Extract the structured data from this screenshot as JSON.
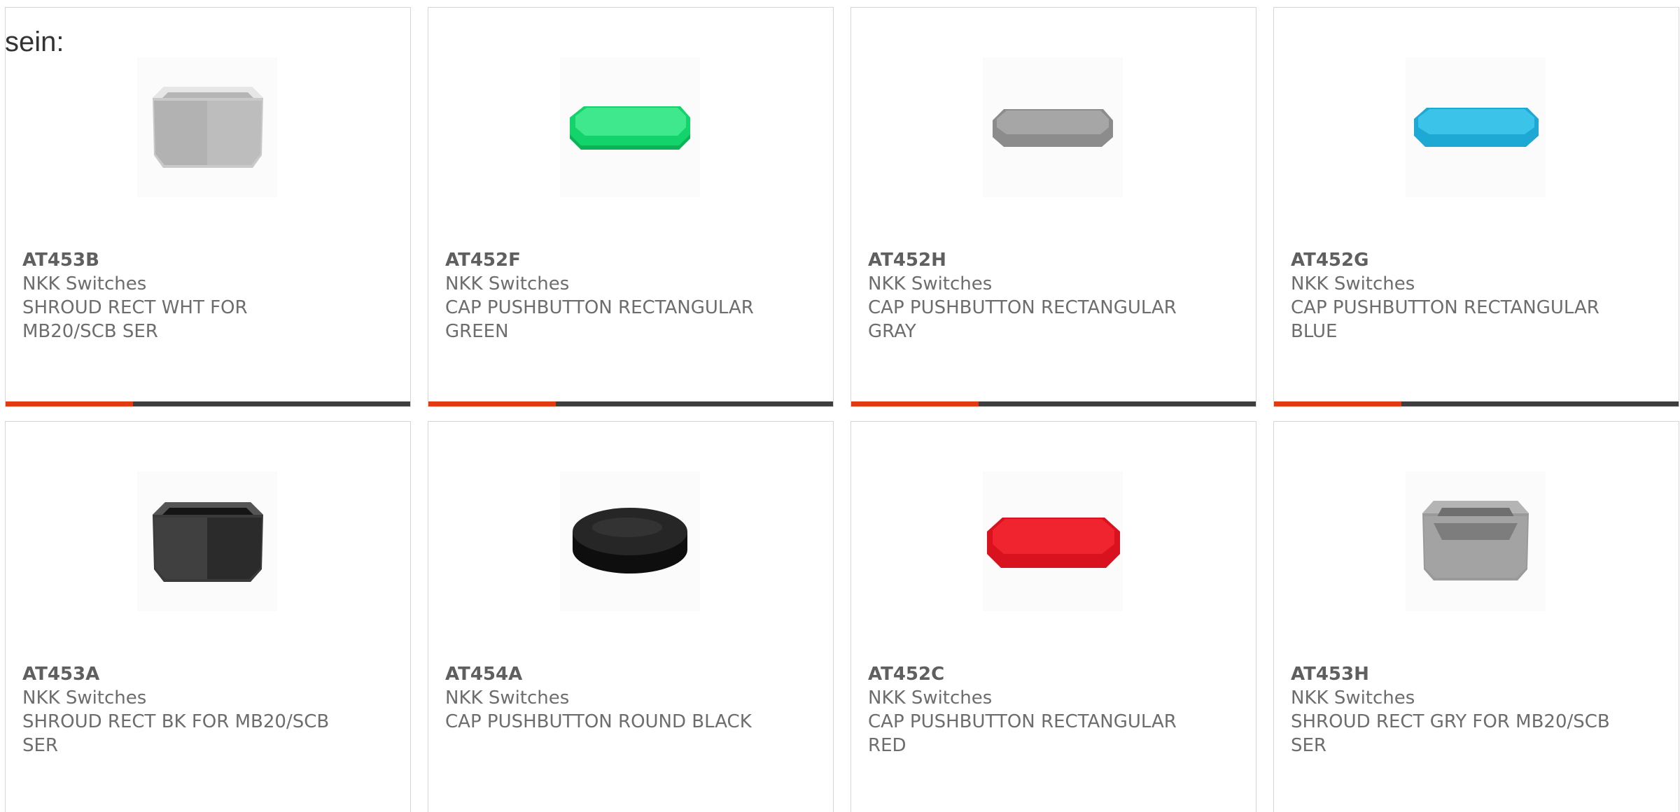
{
  "intro_text": "sein:",
  "colors": {
    "accent": "#e23b12",
    "bar": "#3e3e3e",
    "border": "#d6d6d6",
    "text": "#6d6d6d"
  },
  "products": [
    {
      "part": "AT453B",
      "manufacturer": "NKK Switches",
      "description": "SHROUD RECT WHT FOR MB20/SCB SER",
      "image": "white-rectangular-shroud-image"
    },
    {
      "part": "AT452F",
      "manufacturer": "NKK Switches",
      "description": "CAP PUSHBUTTON RECTANGULAR GREEN",
      "image": "green-rectangular-cap-image"
    },
    {
      "part": "AT452H",
      "manufacturer": "NKK Switches",
      "description": "CAP PUSHBUTTON RECTANGULAR GRAY",
      "image": "gray-rectangular-cap-image"
    },
    {
      "part": "AT452G",
      "manufacturer": "NKK Switches",
      "description": "CAP PUSHBUTTON RECTANGULAR BLUE",
      "image": "blue-rectangular-cap-image"
    },
    {
      "part": "AT453A",
      "manufacturer": "NKK Switches",
      "description": "SHROUD RECT BK FOR MB20/SCB SER",
      "image": "black-rectangular-shroud-image"
    },
    {
      "part": "AT454A",
      "manufacturer": "NKK Switches",
      "description": "CAP PUSHBUTTON ROUND BLACK",
      "image": "black-round-cap-image"
    },
    {
      "part": "AT452C",
      "manufacturer": "NKK Switches",
      "description": "CAP PUSHBUTTON RECTANGULAR RED",
      "image": "red-rectangular-cap-image"
    },
    {
      "part": "AT453H",
      "manufacturer": "NKK Switches",
      "description": "SHROUD RECT GRY FOR MB20/SCB SER",
      "image": "gray-rectangular-shroud-image"
    }
  ]
}
